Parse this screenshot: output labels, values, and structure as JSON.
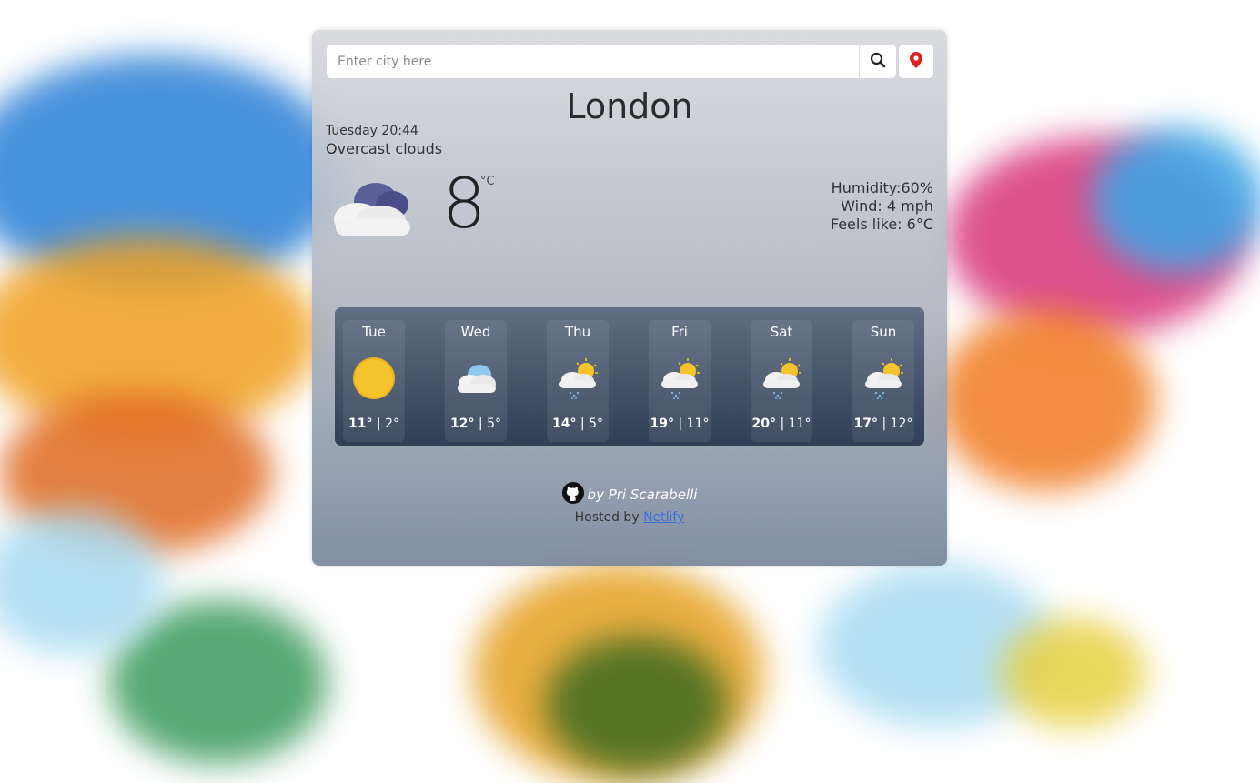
{
  "search": {
    "placeholder": "Enter city here"
  },
  "icons": {
    "search": "search-icon",
    "location": "location-pin-icon",
    "github": "github-icon"
  },
  "colors": {
    "location_pin": "#e02020",
    "link": "#3b6fd8"
  },
  "current": {
    "city": "London",
    "datetime": "Tuesday 20:44",
    "description": "Overcast clouds",
    "temperature": "8",
    "unit": "°C",
    "icon": "overcast-cloud-icon",
    "humidity": "Humidity:60%",
    "wind": "Wind: 4 mph",
    "feels_like": "Feels like: 6°C"
  },
  "forecast": [
    {
      "day": "Tue",
      "icon": "sun-icon",
      "high": "11°",
      "low": "2°"
    },
    {
      "day": "Wed",
      "icon": "cloud-icon",
      "high": "12°",
      "low": "5°"
    },
    {
      "day": "Thu",
      "icon": "sun-cloud-rain-icon",
      "high": "14°",
      "low": "5°"
    },
    {
      "day": "Fri",
      "icon": "sun-cloud-rain-icon",
      "high": "19°",
      "low": "11°"
    },
    {
      "day": "Sat",
      "icon": "sun-cloud-rain-icon",
      "high": "20°",
      "low": "11°"
    },
    {
      "day": "Sun",
      "icon": "sun-cloud-rain-icon",
      "high": "17°",
      "low": "12°"
    }
  ],
  "footer": {
    "author": "by Pri Scarabelli",
    "hosted_prefix": "Hosted by",
    "hosted_link": "Netlify"
  }
}
